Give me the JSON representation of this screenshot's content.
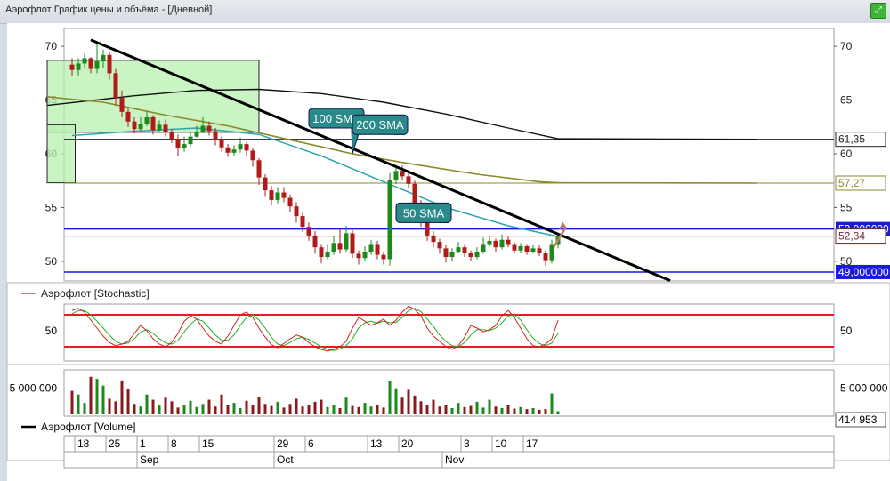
{
  "window": {
    "title": "Аэрофлот График цены и объёма - [Дневной]"
  },
  "colors": {
    "up": "#1b8a1b",
    "down": "#b21a1a",
    "sma50": "#2aa6b0",
    "sma100": "#8a8a2a",
    "sma200": "#111111",
    "level_blue": "#1a1adc",
    "stoch_k": "#d22020",
    "stoch_d": "#20b020",
    "stoch_band": "#e02020",
    "volume_up": "#1b8a1b",
    "volume_down": "#8a1a1a",
    "zone_fill": "#b8f0b0",
    "callout_fill": "#2a8a8a"
  },
  "chart_data": [
    {
      "type": "candlestick",
      "name": "price",
      "ylim": [
        48.5,
        71.5
      ],
      "y_ticks": [
        50,
        55,
        60,
        65,
        70
      ],
      "candles": [
        [
          68.3,
          67.8,
          68.9,
          67.3
        ],
        [
          67.8,
          68.4,
          68.9,
          67.3
        ],
        [
          68.4,
          68.9,
          69.3,
          68.0
        ],
        [
          68.9,
          67.9,
          69.0,
          67.5
        ],
        [
          67.9,
          68.6,
          70.4,
          67.5
        ],
        [
          68.6,
          69.2,
          69.7,
          68.0
        ],
        [
          69.2,
          67.5,
          69.5,
          66.9
        ],
        [
          67.5,
          65.2,
          67.9,
          64.5
        ],
        [
          65.2,
          63.9,
          65.9,
          63.4
        ],
        [
          63.9,
          63.0,
          64.3,
          62.5
        ],
        [
          63.0,
          62.3,
          63.4,
          61.9
        ],
        [
          62.3,
          62.8,
          63.4,
          62.1
        ],
        [
          62.8,
          63.4,
          64.0,
          62.6
        ],
        [
          63.4,
          62.2,
          63.6,
          61.8
        ],
        [
          62.2,
          62.7,
          63.1,
          62.0
        ],
        [
          62.7,
          62.0,
          63.2,
          61.6
        ],
        [
          62.0,
          61.4,
          62.3,
          61.0
        ],
        [
          61.4,
          60.5,
          61.8,
          59.8
        ],
        [
          60.5,
          60.9,
          61.6,
          60.2
        ],
        [
          60.9,
          61.6,
          62.0,
          60.7
        ],
        [
          61.6,
          62.0,
          62.6,
          61.5
        ],
        [
          62.0,
          62.6,
          63.4,
          61.9
        ],
        [
          62.6,
          62.1,
          63.0,
          61.7
        ],
        [
          62.1,
          61.3,
          62.4,
          60.8
        ],
        [
          61.3,
          60.6,
          61.6,
          60.2
        ],
        [
          60.6,
          60.1,
          60.9,
          59.7
        ],
        [
          60.1,
          60.4,
          60.8,
          59.8
        ],
        [
          60.4,
          60.9,
          61.5,
          60.1
        ],
        [
          60.9,
          60.3,
          61.1,
          59.8
        ],
        [
          60.3,
          59.4,
          60.5,
          58.8
        ],
        [
          59.4,
          57.8,
          59.6,
          57.1
        ],
        [
          57.8,
          56.6,
          58.1,
          56.0
        ],
        [
          56.6,
          55.7,
          57.0,
          55.2
        ],
        [
          55.7,
          56.4,
          56.9,
          55.4
        ],
        [
          56.4,
          55.9,
          56.9,
          55.5
        ],
        [
          55.9,
          55.1,
          56.2,
          54.6
        ],
        [
          55.1,
          54.2,
          55.5,
          53.6
        ],
        [
          54.2,
          53.2,
          54.6,
          52.7
        ],
        [
          53.2,
          52.4,
          53.6,
          51.9
        ],
        [
          52.4,
          51.3,
          52.8,
          50.7
        ],
        [
          51.3,
          50.4,
          51.6,
          49.8
        ],
        [
          50.4,
          50.9,
          51.6,
          50.2
        ],
        [
          50.9,
          51.7,
          52.4,
          50.6
        ],
        [
          51.7,
          51.1,
          53.0,
          50.7
        ],
        [
          51.1,
          52.6,
          53.3,
          50.9
        ],
        [
          52.6,
          50.7,
          52.9,
          50.3
        ],
        [
          50.7,
          50.3,
          51.0,
          49.7
        ],
        [
          50.3,
          50.9,
          51.4,
          50.0
        ],
        [
          50.9,
          51.6,
          52.0,
          50.6
        ],
        [
          51.6,
          50.6,
          51.9,
          50.2
        ],
        [
          50.6,
          50.2,
          50.9,
          49.7
        ],
        [
          50.2,
          57.6,
          58.2,
          49.6
        ],
        [
          57.6,
          58.4,
          58.8,
          57.2
        ],
        [
          58.4,
          57.9,
          58.9,
          57.5
        ],
        [
          57.9,
          57.2,
          58.3,
          56.8
        ],
        [
          57.2,
          55.4,
          57.5,
          54.9
        ],
        [
          55.4,
          53.8,
          55.7,
          53.2
        ],
        [
          53.8,
          52.4,
          54.1,
          51.9
        ],
        [
          52.4,
          51.8,
          52.8,
          51.3
        ],
        [
          51.8,
          51.2,
          52.1,
          50.7
        ],
        [
          51.2,
          50.4,
          51.5,
          49.9
        ],
        [
          50.4,
          50.9,
          51.2,
          50.0
        ],
        [
          50.9,
          51.3,
          51.8,
          50.8
        ],
        [
          51.3,
          50.8,
          51.6,
          50.4
        ],
        [
          50.8,
          50.4,
          51.0,
          50.0
        ],
        [
          50.4,
          50.9,
          51.3,
          50.2
        ],
        [
          50.9,
          51.6,
          52.2,
          50.7
        ],
        [
          51.6,
          51.9,
          52.3,
          51.4
        ],
        [
          51.9,
          51.3,
          52.1,
          50.9
        ],
        [
          51.3,
          52.0,
          52.5,
          51.1
        ],
        [
          52.0,
          51.6,
          52.3,
          51.3
        ],
        [
          51.6,
          51.0,
          51.8,
          50.7
        ],
        [
          51.0,
          51.4,
          51.7,
          50.8
        ],
        [
          51.4,
          50.9,
          51.6,
          50.6
        ],
        [
          50.9,
          51.2,
          51.5,
          50.8
        ],
        [
          51.2,
          50.8,
          51.5,
          50.5
        ],
        [
          50.8,
          50.1,
          51.0,
          49.6
        ],
        [
          50.1,
          51.6,
          52.0,
          49.8
        ],
        [
          51.6,
          52.3,
          52.6,
          51.2
        ]
      ],
      "sma50": {
        "label": "50 SMA",
        "points": [
          [
            0,
            61.7
          ],
          [
            10,
            62.1
          ],
          [
            20,
            62.4
          ],
          [
            30,
            61.8
          ],
          [
            40,
            59.8
          ],
          [
            50,
            57.4
          ],
          [
            60,
            55.0
          ],
          [
            70,
            53.3
          ],
          [
            78,
            52.3
          ]
        ]
      },
      "sma100": {
        "label": "100 SMA",
        "points": [
          [
            -4,
            65.3
          ],
          [
            5,
            64.8
          ],
          [
            15,
            63.6
          ],
          [
            25,
            62.6
          ],
          [
            35,
            61.3
          ],
          [
            45,
            60.0
          ],
          [
            55,
            59.0
          ],
          [
            65,
            58.1
          ],
          [
            75,
            57.4
          ],
          [
            78,
            57.3
          ]
        ]
      },
      "sma200": {
        "label": "200 SMA",
        "points": [
          [
            -4,
            64.5
          ],
          [
            10,
            65.4
          ],
          [
            20,
            65.9
          ],
          [
            30,
            66.0
          ],
          [
            40,
            65.6
          ],
          [
            50,
            64.8
          ],
          [
            60,
            63.7
          ],
          [
            70,
            62.4
          ],
          [
            78,
            61.4
          ]
        ]
      },
      "sma200_extend": [
        [
          78,
          61.4
        ],
        [
          110,
          61.35
        ]
      ],
      "sma100_extend": [
        [
          78,
          57.3
        ],
        [
          110,
          57.27
        ]
      ],
      "trendline": [
        [
          3,
          70.6
        ],
        [
          96,
          48.2
        ]
      ],
      "hlines": [
        {
          "value": 61.35,
          "color": "#222222",
          "label": "61,35"
        },
        {
          "value": 57.27,
          "color": "#8a8a2a",
          "label": "57,27"
        },
        {
          "value": 53.0,
          "color": "#1a1adc",
          "label": "53,000000",
          "boxed": true
        },
        {
          "value": 52.34,
          "color": "#6a2a2a",
          "label": "52,34"
        },
        {
          "value": 49.0,
          "color": "#1a1adc",
          "label": "49,000000",
          "boxed": true
        }
      ],
      "zones": [
        {
          "x": [
            -4,
            30
          ],
          "y": [
            62.0,
            68.7
          ]
        },
        {
          "x": [
            -4,
            0.5
          ],
          "y": [
            57.3,
            62.7
          ]
        }
      ],
      "arrow": {
        "from": [
          77.3,
          51.3
        ],
        "to": [
          79.3,
          53.2
        ]
      }
    },
    {
      "type": "line",
      "name": "stochastic",
      "legend": "Аэрофлот [Stochastic]",
      "y_ticks": [
        50
      ],
      "ylim": [
        0,
        100
      ],
      "band_levels": [
        80,
        20
      ],
      "k": [
        88,
        92,
        85,
        70,
        55,
        40,
        28,
        22,
        25,
        30,
        45,
        60,
        50,
        35,
        25,
        20,
        28,
        45,
        68,
        78,
        72,
        55,
        40,
        30,
        25,
        40,
        60,
        80,
        85,
        75,
        55,
        38,
        24,
        18,
        26,
        35,
        42,
        38,
        28,
        20,
        15,
        12,
        15,
        20,
        30,
        55,
        75,
        68,
        60,
        65,
        72,
        60,
        70,
        85,
        96,
        90,
        78,
        55,
        40,
        30,
        20,
        15,
        22,
        38,
        60,
        55,
        48,
        52,
        60,
        78,
        88,
        75,
        55,
        35,
        22,
        20,
        25,
        35,
        70
      ],
      "d": [
        82,
        88,
        88,
        80,
        68,
        55,
        42,
        30,
        25,
        27,
        35,
        48,
        52,
        45,
        35,
        27,
        25,
        32,
        48,
        62,
        72,
        68,
        55,
        42,
        32,
        32,
        42,
        60,
        75,
        80,
        70,
        55,
        38,
        25,
        22,
        28,
        35,
        38,
        34,
        27,
        20,
        15,
        13,
        16,
        22,
        35,
        55,
        65,
        68,
        64,
        68,
        65,
        66,
        75,
        88,
        92,
        86,
        72,
        58,
        42,
        30,
        22,
        20,
        28,
        42,
        52,
        52,
        50,
        55,
        65,
        78,
        80,
        70,
        52,
        36,
        26,
        22,
        27,
        45
      ]
    },
    {
      "type": "bar",
      "name": "volume",
      "legend": "Аэрофлот [Volume]",
      "y_ticks_label": "5 000 000",
      "last_label": "414 953",
      "values": [
        4.5,
        3.8,
        2.2,
        7.2,
        6.8,
        5.5,
        3.0,
        2.5,
        6.5,
        4.8,
        2.0,
        1.5,
        3.8,
        2.8,
        1.8,
        3.2,
        2.5,
        1.3,
        1.8,
        2.6,
        1.4,
        2.0,
        2.8,
        1.5,
        3.8,
        1.8,
        2.2,
        1.2,
        2.6,
        1.8,
        3.4,
        2.0,
        1.6,
        2.4,
        1.3,
        2.0,
        3.0,
        1.5,
        1.8,
        2.4,
        2.8,
        1.4,
        1.8,
        1.2,
        3.2,
        1.6,
        1.4,
        2.2,
        1.5,
        1.8,
        1.3,
        6.4,
        5.0,
        3.2,
        4.7,
        3.6,
        2.5,
        1.8,
        2.8,
        1.5,
        1.8,
        1.2,
        2.2,
        1.4,
        1.6,
        2.4,
        1.3,
        2.8,
        1.5,
        1.2,
        1.8,
        1.1,
        1.4,
        1.0,
        1.2,
        0.9,
        1.0,
        4.0,
        0.6
      ],
      "last_value": 0.414953
    }
  ],
  "x_axis": {
    "day_labels": [
      {
        "i": 1,
        "label": "18"
      },
      {
        "i": 6,
        "label": "25"
      },
      {
        "i": 11,
        "label": "1"
      },
      {
        "i": 16,
        "label": "8"
      },
      {
        "i": 21,
        "label": "15"
      },
      {
        "i": 33,
        "label": "29"
      },
      {
        "i": 38,
        "label": "6"
      },
      {
        "i": 48,
        "label": "13"
      },
      {
        "i": 53,
        "label": "20"
      },
      {
        "i": 63,
        "label": "3"
      },
      {
        "i": 68,
        "label": "10"
      },
      {
        "i": 73,
        "label": "17"
      }
    ],
    "month_labels": [
      {
        "i": 11,
        "label": "Sep"
      },
      {
        "i": 33,
        "label": "Oct"
      },
      {
        "i": 60,
        "label": "Nov"
      }
    ]
  },
  "right_axis_ticks": [
    70,
    65,
    60,
    55,
    50
  ],
  "annotations": [
    {
      "label": "100 SMA",
      "x": 38,
      "y": 62.4,
      "tail": [
        45,
        60.0
      ]
    },
    {
      "label": "200 SMA",
      "x": 45,
      "y": 61.8,
      "tail": [
        52,
        62.6
      ]
    },
    {
      "label": "50 SMA",
      "x": 52,
      "y": 53.6,
      "tail": [
        56,
        55.2
      ]
    }
  ]
}
